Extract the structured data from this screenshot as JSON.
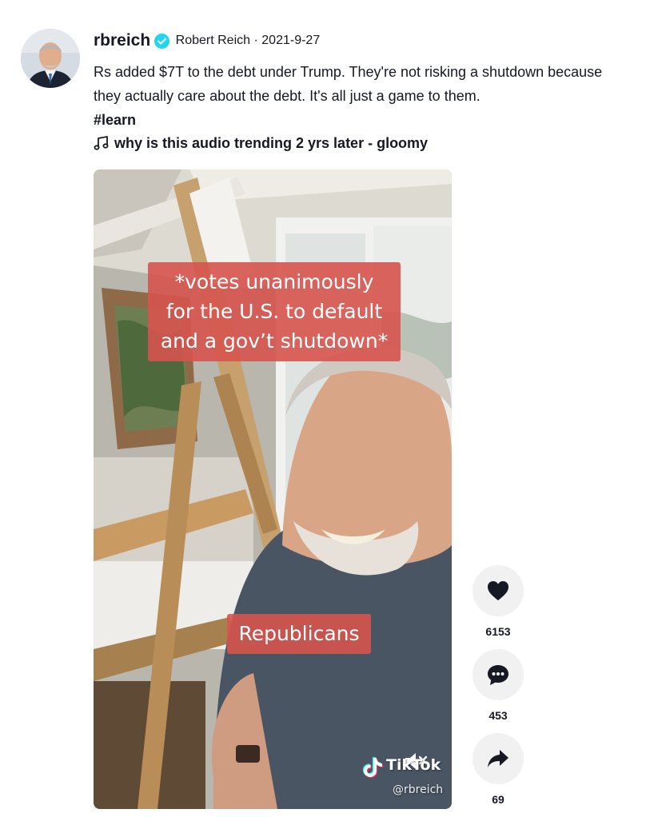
{
  "author": {
    "username": "rbreich",
    "nickname": "Robert Reich",
    "separator": "·",
    "date": "2021-9-27"
  },
  "caption": {
    "text": "Rs added $7T to the debt under Trump. They're not risking a shutdown because they actually care about the debt. It's all just a game to them.",
    "hashtag": "#learn"
  },
  "music": {
    "icon": "music-note-icon",
    "title": "why is this audio trending 2 yrs later - gloomy"
  },
  "video": {
    "overlay_top_lines": [
      "*votes unanimously",
      "for the U.S. to default",
      "and a gov’t shutdown*"
    ],
    "overlay_bottom": "Republicans",
    "watermark_brand": "TikTok",
    "watermark_handle": "@rbreich",
    "muted": true,
    "overlay_color": "#d6544e"
  },
  "actions": {
    "likes": "6153",
    "comments": "453",
    "shares": "69"
  },
  "colors": {
    "text": "#161823",
    "verified": "#20d5ec",
    "button_bg": "#f1f1f2"
  }
}
